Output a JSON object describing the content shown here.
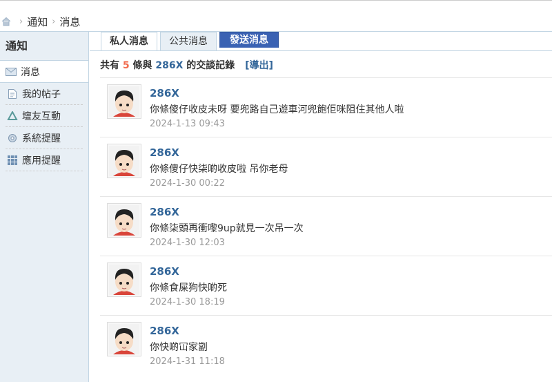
{
  "breadcrumb": {
    "items": [
      "通知",
      "消息"
    ]
  },
  "sidebar": {
    "title": "通知",
    "items": [
      {
        "label": "消息",
        "icon": "envelope-icon"
      },
      {
        "label": "我的帖子",
        "icon": "document-icon"
      },
      {
        "label": "壇友互動",
        "icon": "recycle-icon"
      },
      {
        "label": "系統提醒",
        "icon": "gear-icon"
      },
      {
        "label": "應用提醒",
        "icon": "grid-icon"
      }
    ]
  },
  "tabs": {
    "private": "私人消息",
    "public": "公共消息",
    "send": "發送消息"
  },
  "summary": {
    "prefix": "共有",
    "count": "5",
    "middle": "條與",
    "user": "286X",
    "suffix": "的交談記錄",
    "export": "[導出]"
  },
  "messages": [
    {
      "name": "286X",
      "text": "你條傻仔收皮未呀 要兜路自己遊車河兜飽佢咪阻住其他人啦",
      "time": "2024-1-13 09:43"
    },
    {
      "name": "286X",
      "text": "你條傻仔快柒啲收皮啦 吊你老母",
      "time": "2024-1-30 00:22"
    },
    {
      "name": "286X",
      "text": "你條柒頭再衝嚟9up就見一次吊一次",
      "time": "2024-1-30 12:03"
    },
    {
      "name": "286X",
      "text": "你條食屎狗快啲死",
      "time": "2024-1-30 18:19"
    },
    {
      "name": "286X",
      "text": "你快啲冚家劏",
      "time": "2024-1-31 11:18"
    }
  ],
  "colors": {
    "accent": "#336699",
    "count": "#f26c4f",
    "send_button": "#3a62b3",
    "sidebar_bg": "#e8eff5"
  }
}
